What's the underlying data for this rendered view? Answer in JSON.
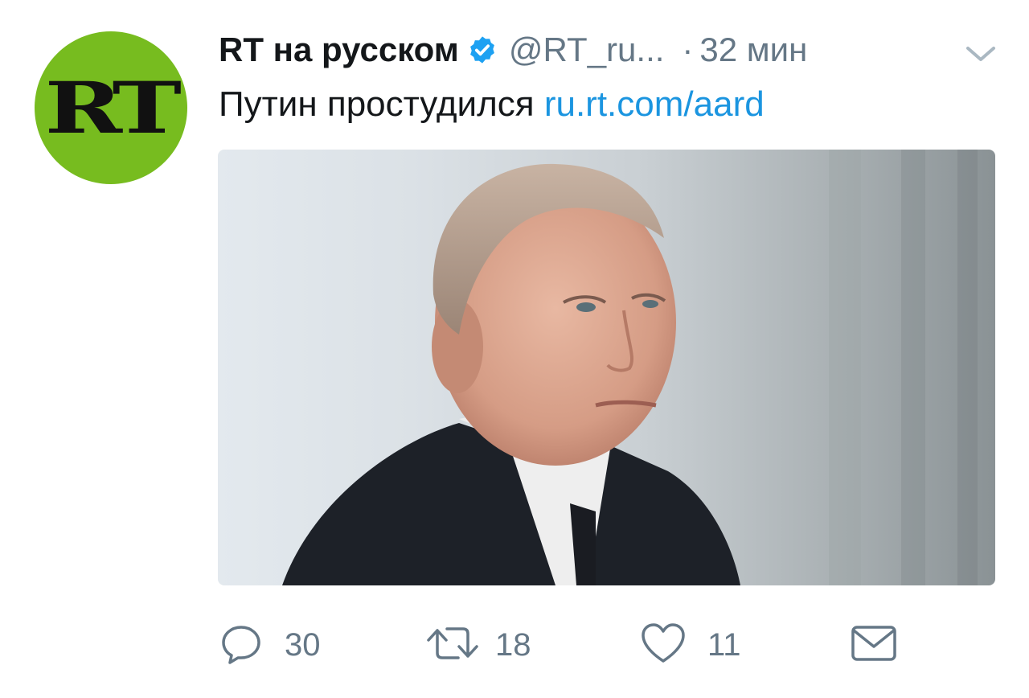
{
  "author": {
    "avatar_text": "RT",
    "avatar_color": "#77bc1f",
    "display_name": "RT на русском",
    "verified": true,
    "handle": "@RT_ru...",
    "separator": "·",
    "time": "32 мин"
  },
  "tweet": {
    "text": "Путин простудился",
    "link": "ru.rt.com/aard",
    "link_color": "#1b95e0"
  },
  "media": {
    "kind": "photo",
    "subject": "portrait"
  },
  "actions": {
    "reply_count": "30",
    "retweet_count": "18",
    "like_count": "11"
  },
  "icons": {
    "verified": "verified-badge-icon",
    "caret": "chevron-down-icon",
    "reply": "reply-icon",
    "retweet": "retweet-icon",
    "like": "heart-icon",
    "dm": "envelope-icon"
  }
}
